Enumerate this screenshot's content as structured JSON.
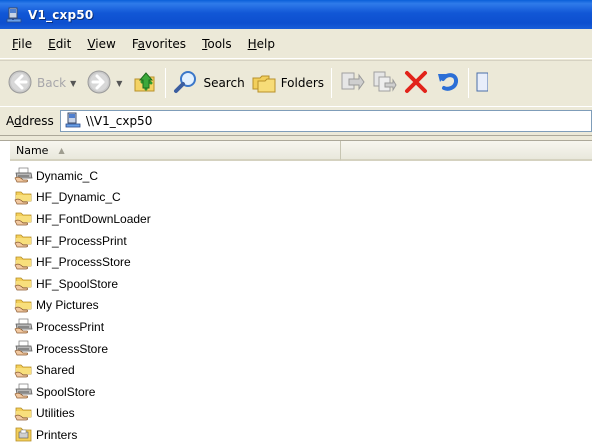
{
  "window": {
    "title": "V1_cxp50"
  },
  "menu": {
    "items": [
      {
        "accel": "F",
        "rest": "ile"
      },
      {
        "accel": "E",
        "rest": "dit"
      },
      {
        "accel": "V",
        "rest": "iew"
      },
      {
        "pre": "F",
        "accel": "a",
        "rest": "vorites"
      },
      {
        "accel": "T",
        "rest": "ools"
      },
      {
        "accel": "H",
        "rest": "elp"
      }
    ]
  },
  "toolbar": {
    "back_label": "Back",
    "search_label": "Search",
    "folders_label": "Folders"
  },
  "address": {
    "label_pre": "A",
    "label_accel": "d",
    "label_rest": "dress",
    "value": "\\\\V1_cxp50"
  },
  "list": {
    "column_name": "Name",
    "items": [
      {
        "name": "Dynamic_C",
        "icon": "shared-printer-icon"
      },
      {
        "name": "HF_Dynamic_C",
        "icon": "shared-folder-icon"
      },
      {
        "name": "HF_FontDownLoader",
        "icon": "shared-folder-icon"
      },
      {
        "name": "HF_ProcessPrint",
        "icon": "shared-folder-icon"
      },
      {
        "name": "HF_ProcessStore",
        "icon": "shared-folder-icon"
      },
      {
        "name": "HF_SpoolStore",
        "icon": "shared-folder-icon"
      },
      {
        "name": "My Pictures",
        "icon": "shared-folder-icon"
      },
      {
        "name": "ProcessPrint",
        "icon": "shared-printer-icon"
      },
      {
        "name": "ProcessStore",
        "icon": "shared-printer-icon"
      },
      {
        "name": "Shared",
        "icon": "shared-folder-icon"
      },
      {
        "name": "SpoolStore",
        "icon": "shared-printer-icon"
      },
      {
        "name": "Utilities",
        "icon": "shared-folder-icon"
      },
      {
        "name": "Printers",
        "icon": "printers-folder-icon"
      }
    ]
  }
}
